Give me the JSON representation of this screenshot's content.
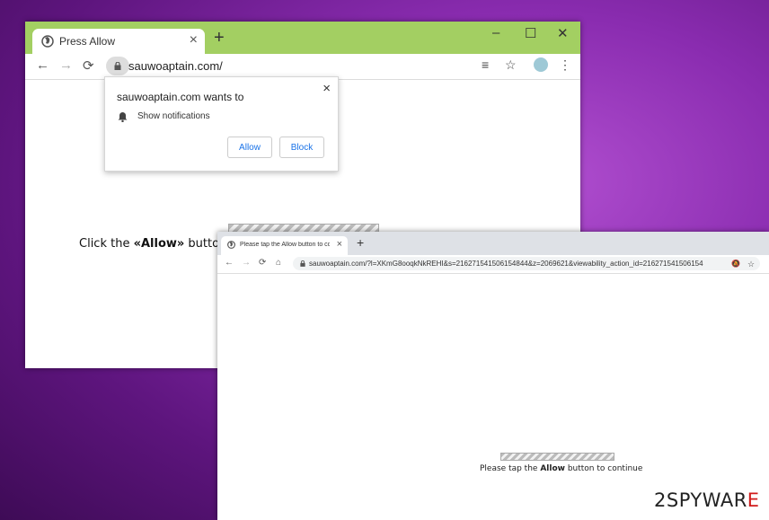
{
  "window1": {
    "tab_title": "Press Allow",
    "tab_close": "×",
    "new_tab": "+",
    "controls": {
      "minimize": "–",
      "maximize": "☐",
      "close": "✕"
    },
    "nav": {
      "back": "←",
      "forward": "→",
      "reload": "⟳"
    },
    "url": "sauwoaptain.com/",
    "icons": {
      "reader": "≡",
      "bookmark": "☆",
      "menu": "⋮"
    },
    "page_text_start": "Click the ",
    "page_text_bold": "«Allow»",
    "page_text_end": " button t"
  },
  "popup": {
    "title": "sauwoaptain.com wants to",
    "close": "×",
    "permission": "Show notifications",
    "allow_label": "Allow",
    "block_label": "Block"
  },
  "window2": {
    "tab_title": "Please tap the Allow button to co",
    "tab_close": "×",
    "new_tab": "+",
    "nav": {
      "back": "←",
      "forward": "→",
      "reload": "⟳",
      "home": "⌂"
    },
    "url": "sauwoaptain.com/?l=XKmG8ooqkNkREHI&s=216271541506154844&z=2069621&viewability_action_id=216271541506154",
    "icons": {
      "bell": "🔕",
      "bookmark": "☆"
    },
    "page_text_start": "Please tap the ",
    "page_text_bold": "Allow",
    "page_text_end": " button to continue"
  },
  "watermark": {
    "part1": "2SPYWAR",
    "part2": "E"
  }
}
